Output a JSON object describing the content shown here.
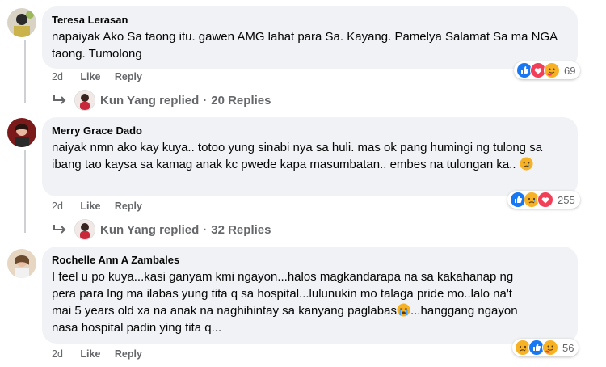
{
  "comments": [
    {
      "author": "Teresa Lerasan",
      "text": "napaiyak Ako Sa taong itu. gawen AMG lahat para Sa. Kayang. Pamelya Salamat Sa ma NGA taong. Tumolong",
      "time": "2d",
      "like_label": "Like",
      "reply_label": "Reply",
      "reaction_icons": [
        "like-icon",
        "love-icon",
        "care-icon"
      ],
      "reaction_count": "69",
      "replied_by": "Kun Yang replied",
      "replies_count": "20 Replies"
    },
    {
      "author": "Merry Grace Dado",
      "text": "naiyak nmn ako kay kuya.. totoo yung sinabi nya sa huli. mas ok pang humingi ng tulong sa ibang tao kaysa sa kamag anak kc pwede kapa masumbatan.. embes na tulongan ka..",
      "time": "2d",
      "like_label": "Like",
      "reply_label": "Reply",
      "reaction_icons": [
        "like-icon",
        "sad-icon",
        "love-icon"
      ],
      "reaction_count": "255",
      "replied_by": "Kun Yang replied",
      "replies_count": "32 Replies"
    },
    {
      "author": "Rochelle Ann A Zambales",
      "text_lines": [
        "I feel u po kuya...kasi ganyam kmi ngayon...halos magkandarapa na sa kakahanap ng",
        "pera para lng ma ilabas yung tita q sa hospital...lulunukin mo talaga pride mo..lalo na't",
        "mai 5 years old xa na anak na naghihintay sa kanyang paglabas",
        "...hanggang ngayon",
        "nasa hospital padin ying tita q..."
      ],
      "time": "2d",
      "like_label": "Like",
      "reply_label": "Reply",
      "reaction_icons": [
        "sad-icon",
        "like-icon",
        "care-icon"
      ],
      "reaction_count": "56"
    }
  ],
  "colors": {
    "bubble": "#f0f2f5",
    "meta": "#65676b",
    "like_blue": "#1877f2",
    "love_red": "#f33e58",
    "haha_yellow": "#f7b125"
  }
}
